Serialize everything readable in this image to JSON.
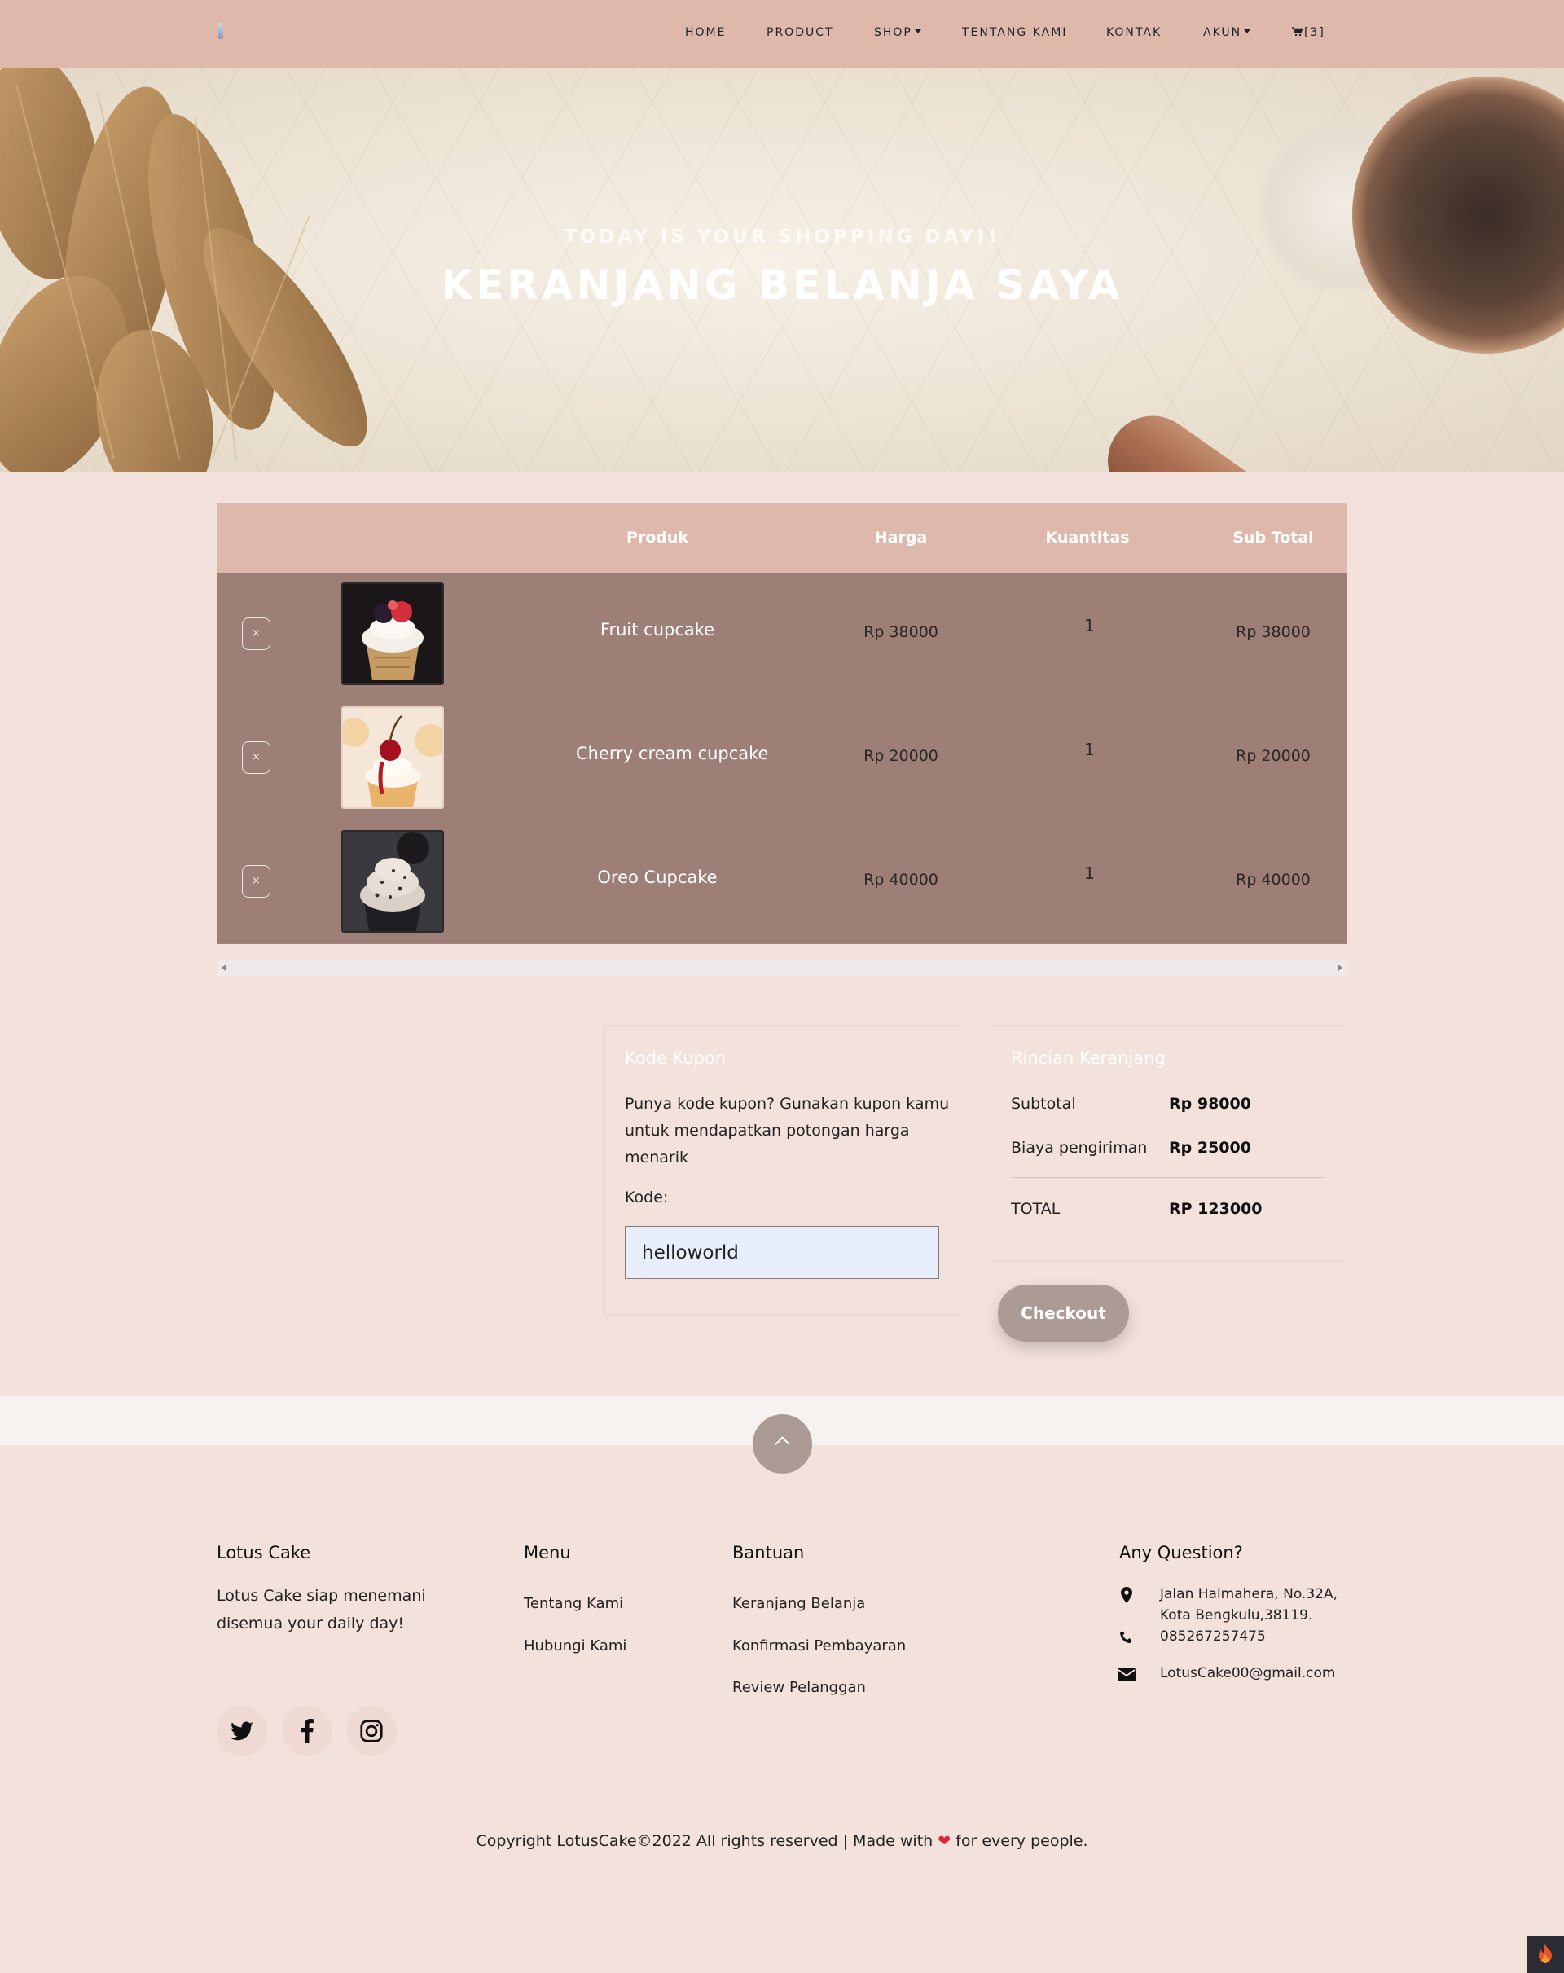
{
  "nav": {
    "items": [
      {
        "label": "HOME"
      },
      {
        "label": "PRODUCT"
      },
      {
        "label": "SHOP"
      },
      {
        "label": "TENTANG KAMI"
      },
      {
        "label": "KONTAK"
      },
      {
        "label": "AKUN"
      }
    ],
    "cart_count": "[3]"
  },
  "hero": {
    "subtitle": "TODAY IS YOUR SHOPPING DAY!!",
    "title": "KERANJANG BELANJA SAYA"
  },
  "cart": {
    "headers": {
      "product": "Produk",
      "price": "Harga",
      "quantity": "Kuantitas",
      "subtotal": "Sub Total"
    },
    "remove_symbol": "×",
    "rows": [
      {
        "name": "Fruit cupcake",
        "price": "Rp 38000",
        "qty": "1",
        "subtotal": "Rp 38000"
      },
      {
        "name": "Cherry cream cupcake",
        "price": "Rp 20000",
        "qty": "1",
        "subtotal": "Rp 20000"
      },
      {
        "name": "Oreo Cupcake",
        "price": "Rp 40000",
        "qty": "1",
        "subtotal": "Rp 40000"
      }
    ]
  },
  "coupon": {
    "title": "Kode Kupon",
    "description": "Punya kode kupon? Gunakan kupon kamu untuk mendapatkan potongan harga menarik",
    "label": "Kode:",
    "value": "helloworld"
  },
  "summary": {
    "title": "Rincian Keranjang",
    "subtotal_label": "Subtotal",
    "subtotal_value": "Rp 98000",
    "shipping_label": "Biaya pengiriman",
    "shipping_value": "Rp 25000",
    "total_label": "TOTAL",
    "total_value": "RP 123000"
  },
  "checkout_label": "Checkout",
  "footer": {
    "brand": {
      "title": "Lotus Cake",
      "text": "Lotus Cake siap menemani disemua your daily day!"
    },
    "menu": {
      "title": "Menu",
      "links": [
        "Tentang Kami",
        "Hubungi Kami"
      ]
    },
    "help": {
      "title": "Bantuan",
      "links": [
        "Keranjang Belanja",
        "Konfirmasi Pembayaran",
        "Review Pelanggan"
      ]
    },
    "contact": {
      "title": "Any Question?",
      "address_line1": "Jalan Halmahera, No.32A,",
      "address_line2": "Kota Bengkulu,38119.",
      "phone": "085267257475",
      "email": "LotusCake00@gmail.com"
    },
    "social": [
      "twitter-icon",
      "facebook-icon",
      "instagram-icon"
    ],
    "copyright_before": "Copyright LotusCake©2022 All rights reserved | Made with",
    "copyright_after": "for every people."
  },
  "colors": {
    "navbar": "#dfb8ac",
    "page_bg": "#f3e1dc",
    "table_body": "#9d7f77",
    "button": "#ac9a95",
    "heart": "#e0243c"
  }
}
